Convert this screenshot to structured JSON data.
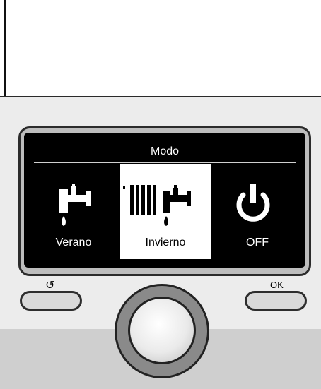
{
  "screen": {
    "title": "Modo",
    "modes": [
      {
        "label": "Verano",
        "icon": "tap-icon",
        "selected": false
      },
      {
        "label": "Invierno",
        "icon": "radiator-tap-icon",
        "selected": true
      },
      {
        "label": "OFF",
        "icon": "power-icon",
        "selected": false
      }
    ]
  },
  "controls": {
    "back_icon": "↺",
    "ok_label": "OK"
  }
}
